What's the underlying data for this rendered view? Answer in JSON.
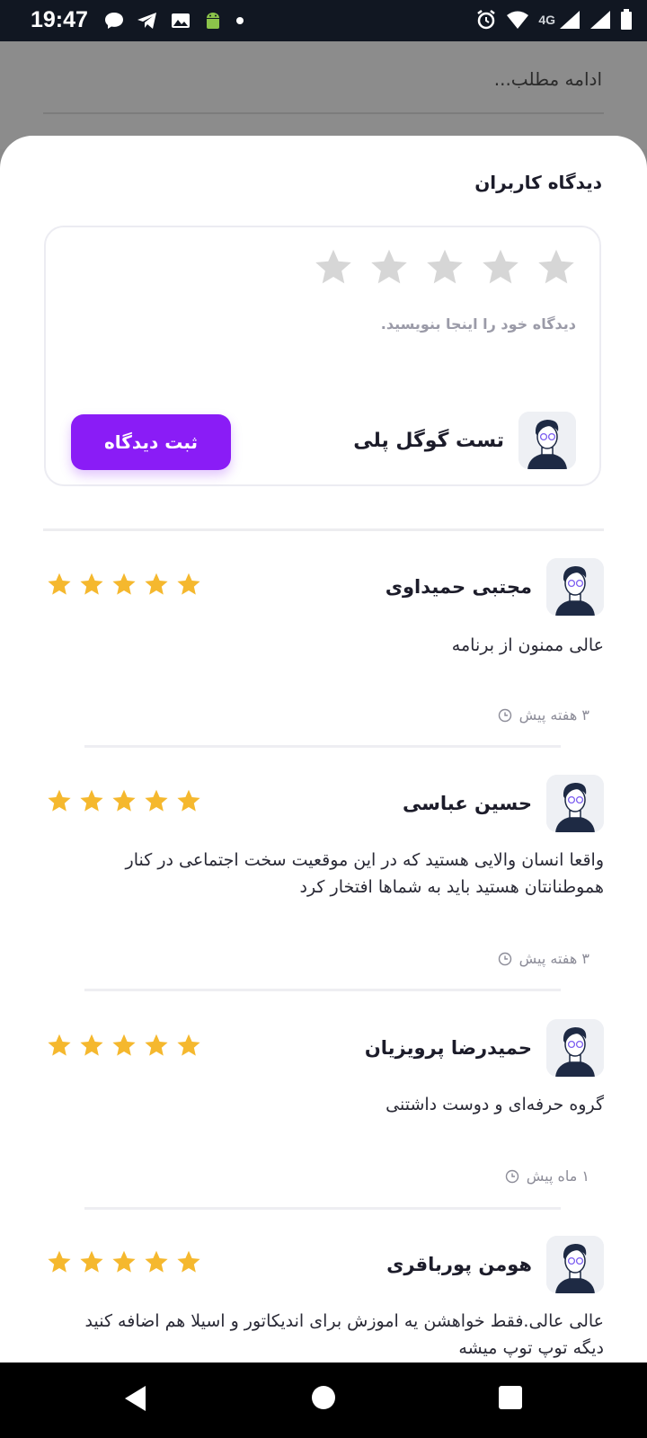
{
  "status_bar": {
    "time": "19:47",
    "left_icons": [
      "chat-bubble-icon",
      "telegram-icon",
      "gallery-icon",
      "android-icon",
      "dot-icon"
    ],
    "right_icons": [
      "alarm-icon",
      "wifi-icon",
      "cell-signal-icon",
      "cell-signal-icon",
      "battery-icon"
    ],
    "network": "4G"
  },
  "background_page": {
    "read_more": "ادامه مطلب..."
  },
  "sheet": {
    "title": "دیدگاه کاربران",
    "compose": {
      "star_count": 5,
      "placeholder": "دیدگاه خود را اینجا بنویسید.",
      "user_name": "تست گوگل پلی",
      "submit_label": "ثبت دیدگاه"
    },
    "reviews": [
      {
        "name": "مجتبی حمیداوی",
        "rating": 5,
        "text": "عالی ممنون از برنامه",
        "time": "۳ هفته پیش"
      },
      {
        "name": "حسین عباسی",
        "rating": 5,
        "text": "واقعا انسان والایی هستید که در این موقعیت سخت اجتماعی در کنار هموطنانتان هستید باید به شماها افتخار کرد",
        "time": "۳ هفته پیش"
      },
      {
        "name": "حمیدرضا پرویزیان",
        "rating": 5,
        "text": "گروه حرفه‌ای و دوست داشتنی",
        "time": "۱ ماه پیش"
      },
      {
        "name": "هومن پورباقری",
        "rating": 5,
        "text": "عالی عالی.فقط خواهشن یه اموزش برای اندیکاتور و اسیلا هم اضافه کنید دیگه توپ توپ میشه",
        "time": ""
      }
    ]
  },
  "colors": {
    "accent": "#8a1cf6",
    "star_filled": "#f5b82e",
    "star_empty": "#d6d6d6",
    "status_bar": "#111722"
  },
  "nav_bar": {
    "buttons": [
      "back-icon",
      "home-icon",
      "recents-icon"
    ]
  }
}
